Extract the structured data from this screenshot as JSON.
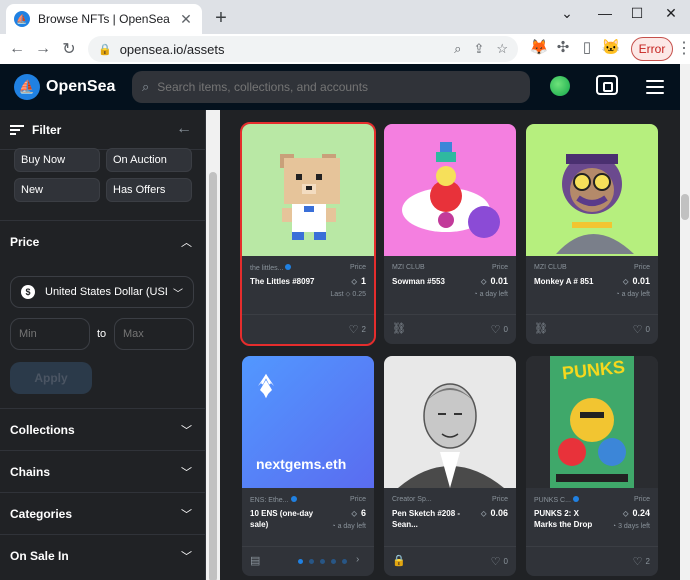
{
  "browser": {
    "tab_title": "Browse NFTs | OpenSea",
    "tab_close": "✕",
    "new_tab": "+",
    "url": "opensea.io/assets",
    "error_label": "Error",
    "window_controls": [
      "⌄",
      "—",
      "☐",
      "✕"
    ]
  },
  "header": {
    "brand": "OpenSea",
    "search_placeholder": "Search items, collections, and accounts"
  },
  "sidebar": {
    "title": "Filter",
    "status_chips": [
      "Buy Now",
      "On Auction",
      "New",
      "Has Offers"
    ],
    "price_section": "Price",
    "currency": "United States Dollar (USD)",
    "min_placeholder": "Min",
    "max_placeholder": "Max",
    "to_label": "to",
    "apply_label": "Apply",
    "sections": [
      "Collections",
      "Chains",
      "Categories",
      "On Sale In"
    ]
  },
  "cards": [
    {
      "collection": "the littles...",
      "verified": true,
      "name": "The Littles #8097",
      "price_label": "Price",
      "price": "1",
      "sub": "Last ⬦ 0.25",
      "likes": "2",
      "selected": true
    },
    {
      "collection": "MZI CLUB",
      "verified": false,
      "name": "Sowman #553",
      "price_label": "Price",
      "price": "0.01",
      "sub": "◔ a day left",
      "likes": "0",
      "selected": false
    },
    {
      "collection": "MZI CLUB",
      "verified": false,
      "name": "Monkey A # 851",
      "price_label": "Price",
      "price": "0.01",
      "sub": "◔ a day left",
      "likes": "0",
      "selected": false
    },
    {
      "collection": "ENS: Ethe...",
      "verified": true,
      "name": "10 ENS (one-day sale)",
      "price_label": "Price",
      "price": "6",
      "sub": "◔ a day left",
      "likes": "",
      "selected": false
    },
    {
      "collection": "Creator Sp...",
      "verified": false,
      "name": "Pen Sketch #208 - Sean...",
      "price_label": "Price",
      "price": "0.06",
      "sub": "",
      "likes": "0",
      "selected": false
    },
    {
      "collection": "PUNKS C...",
      "verified": true,
      "name": "PUNKS 2: X Marks the Drop",
      "price_label": "Price",
      "price": "0.24",
      "sub": "◔ 3 days left",
      "likes": "2",
      "selected": false
    }
  ],
  "ens_image_text": "nextgems.eth",
  "punks_image_text": "PUNKS",
  "colors": {
    "accent": "#2081e2",
    "header_bg": "#04111d",
    "page_bg": "#202225",
    "card_bg": "#303339",
    "selected_outline": "#e52d2d"
  }
}
